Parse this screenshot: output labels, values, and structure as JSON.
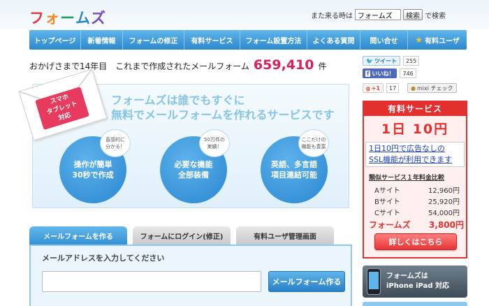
{
  "header": {
    "logo_chars": [
      {
        "ch": "フ",
        "color": "#e8383d"
      },
      {
        "ch": "ォ",
        "color": "#f08a24"
      },
      {
        "ch": "ー",
        "color": "#1aa260"
      },
      {
        "ch": "ム",
        "color": "#2a84d2"
      },
      {
        "ch": "ズ",
        "color": "#7a4bb8"
      }
    ],
    "search_prefix": "また来る時は",
    "search_value": "フォームズ",
    "search_button": "検索",
    "search_suffix": "で検索"
  },
  "nav": {
    "items": [
      {
        "label": "トップページ"
      },
      {
        "label": "新着情報"
      },
      {
        "label": "フォームの修正"
      },
      {
        "label": "有料サービス"
      },
      {
        "label": "フォーム設置方法"
      },
      {
        "label": "よくある質問"
      },
      {
        "label": "問い合せ"
      },
      {
        "label": "有料ユーザ",
        "icon": "star-icon"
      }
    ]
  },
  "counter": {
    "prefix": "おかげさまで14年目　これまで作成されたメールフォーム",
    "number": "659,410",
    "suffix": "件"
  },
  "hero": {
    "title_line1": "フォームズは誰でもすぐに",
    "title_line2": "無料でメールフォームを作れるサービスです",
    "badge": "スマホ\nタブレット\n対応",
    "circles": [
      {
        "text": "操作が簡単\n30秒で作成",
        "bubble": "直感的に\n分かる！"
      },
      {
        "text": "必要な機能\n全部装備",
        "bubble": "50万件の\n実績！"
      },
      {
        "text": "英語、多言語\n項目連結可能",
        "bubble": "ここだけの\n機能も豊富"
      }
    ]
  },
  "tabs": [
    {
      "label": "メールフォームを作る"
    },
    {
      "label": "フォームにログイン(修正)"
    },
    {
      "label": "有料ユーザ管理画面"
    }
  ],
  "form": {
    "email_label": "メールアドレスを入力してください",
    "email_value": "",
    "create_button": "メールフォーム作る"
  },
  "social": {
    "tweet_label": "ツイート",
    "tweet_count": "255",
    "like_label": "いいね！",
    "like_count": "746",
    "gplus_label": "+1",
    "gplus_count": "17",
    "mixi_label": "mixi チェック"
  },
  "paid": {
    "header": "有料サービス",
    "price": "1日 10円",
    "note": "1日10円で広告なしの SSL機能が利用できます",
    "compare_title": "類似サービス１年料金比較",
    "rows": [
      {
        "name": "Aサイト",
        "price": "12,960円"
      },
      {
        "name": "Bサイト",
        "price": "25,920円"
      },
      {
        "name": "Cサイト",
        "price": "54,000円"
      },
      {
        "name": "フォームズ",
        "price": "3,800円"
      }
    ],
    "detail_button": "詳しくはこちら"
  },
  "iphone_banner": "フォームズは\niPhone iPad 対応",
  "colors": {
    "accent_blue": "#2d88cc",
    "accent_red": "#e3302f",
    "counter_pink": "#d6205f"
  }
}
